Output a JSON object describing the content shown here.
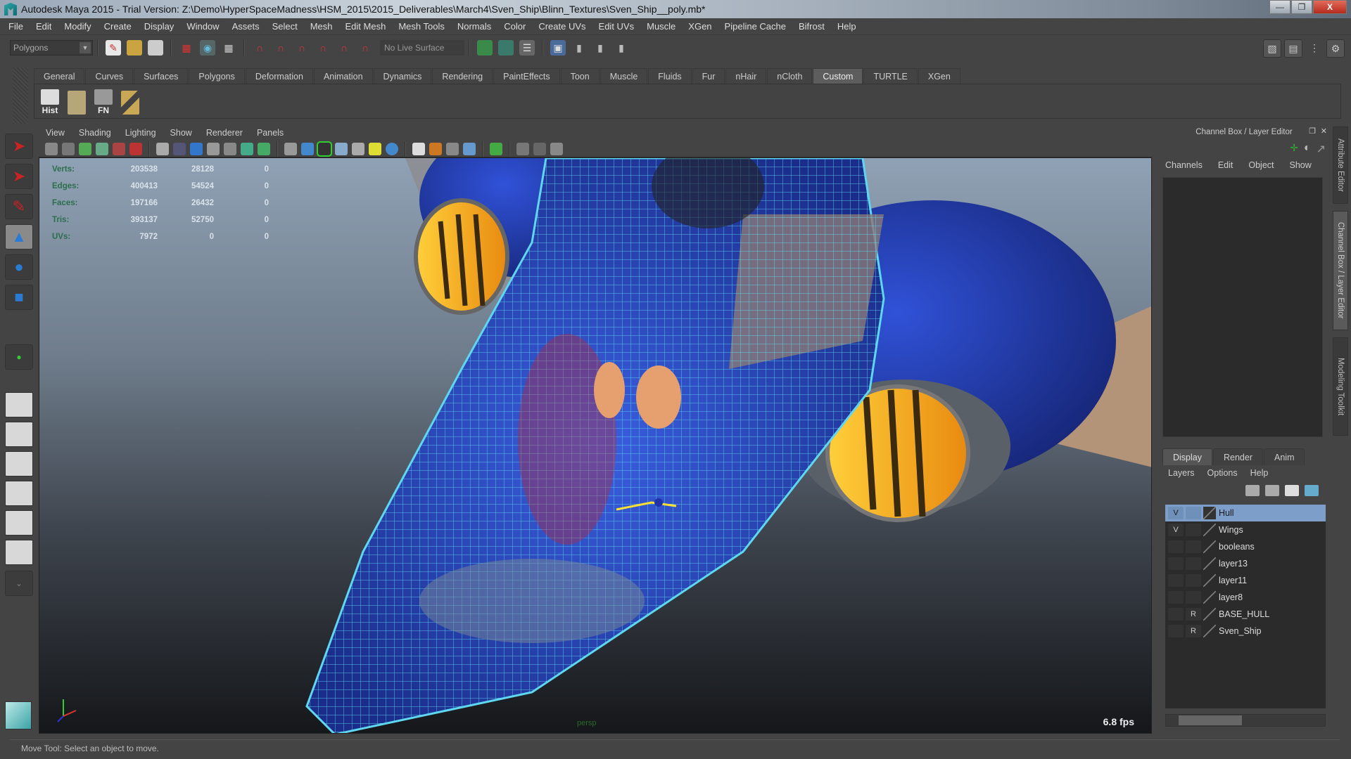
{
  "window": {
    "title": "Autodesk Maya 2015 - Trial Version: Z:\\Demo\\HyperSpaceMadness\\HSM_2015\\2015_Deliverables\\March4\\Sven_Ship\\Blinn_Textures\\Sven_Ship__poly.mb*",
    "controls": [
      "minimize",
      "restore",
      "close"
    ]
  },
  "menubar": [
    "File",
    "Edit",
    "Modify",
    "Create",
    "Display",
    "Window",
    "Assets",
    "Select",
    "Mesh",
    "Edit Mesh",
    "Mesh Tools",
    "Normals",
    "Color",
    "Create UVs",
    "Edit UVs",
    "Muscle",
    "XGen",
    "Pipeline Cache",
    "Bifrost",
    "Help"
  ],
  "statusline": {
    "menuset": "Polygons",
    "live_surface": "No Live Surface"
  },
  "shelf": {
    "tabs": [
      "General",
      "Curves",
      "Surfaces",
      "Polygons",
      "Deformation",
      "Animation",
      "Dynamics",
      "Rendering",
      "PaintEffects",
      "Toon",
      "Muscle",
      "Fluids",
      "Fur",
      "nHair",
      "nCloth",
      "Custom",
      "TURTLE",
      "XGen"
    ],
    "active_tab": "Custom",
    "buttons": [
      {
        "label": "Hist",
        "icon": "history-icon"
      },
      {
        "label": "",
        "icon": "delete-history-icon"
      },
      {
        "label": "FN",
        "icon": "freeze-normals-icon"
      },
      {
        "label": "",
        "icon": "pivot-icon"
      }
    ]
  },
  "viewport": {
    "menus": [
      "View",
      "Shading",
      "Lighting",
      "Show",
      "Renderer",
      "Panels"
    ],
    "hud": [
      {
        "label": "Verts:",
        "values": [
          "203538",
          "28128",
          "0"
        ]
      },
      {
        "label": "Edges:",
        "values": [
          "400413",
          "54524",
          "0"
        ]
      },
      {
        "label": "Faces:",
        "values": [
          "197166",
          "26432",
          "0"
        ]
      },
      {
        "label": "Tris:",
        "values": [
          "393137",
          "52750",
          "0"
        ]
      },
      {
        "label": "UVs:",
        "values": [
          "7972",
          "0",
          "0"
        ]
      }
    ],
    "camera": "persp",
    "fps": "6.8 fps"
  },
  "channel_box": {
    "title": "Channel Box / Layer Editor",
    "menus": [
      "Channels",
      "Edit",
      "Object",
      "Show"
    ]
  },
  "layer_editor": {
    "tabs": [
      "Display",
      "Render",
      "Anim"
    ],
    "active_tab": "Display",
    "menus": [
      "Layers",
      "Options",
      "Help"
    ],
    "layers": [
      {
        "name": "Hull",
        "v": "V",
        "p": "",
        "selected": true
      },
      {
        "name": "Wings",
        "v": "V",
        "p": "",
        "selected": false
      },
      {
        "name": "booleans",
        "v": "",
        "p": "",
        "selected": false
      },
      {
        "name": "layer13",
        "v": "",
        "p": "",
        "selected": false
      },
      {
        "name": "layer11",
        "v": "",
        "p": "",
        "selected": false
      },
      {
        "name": "layer8",
        "v": "",
        "p": "",
        "selected": false
      },
      {
        "name": "BASE_HULL",
        "v": "",
        "p": "R",
        "selected": false
      },
      {
        "name": "Sven_Ship",
        "v": "",
        "p": "R",
        "selected": false
      }
    ]
  },
  "side_tabs": [
    "Attribute Editor",
    "Channel Box / Layer Editor",
    "Modeling Toolkit"
  ],
  "helpline": "Move Tool: Select an object to move.",
  "colors": {
    "selection": "#7c9ec9",
    "wireframe": "#5fd7f0",
    "hud_label": "#2c6e4c"
  }
}
